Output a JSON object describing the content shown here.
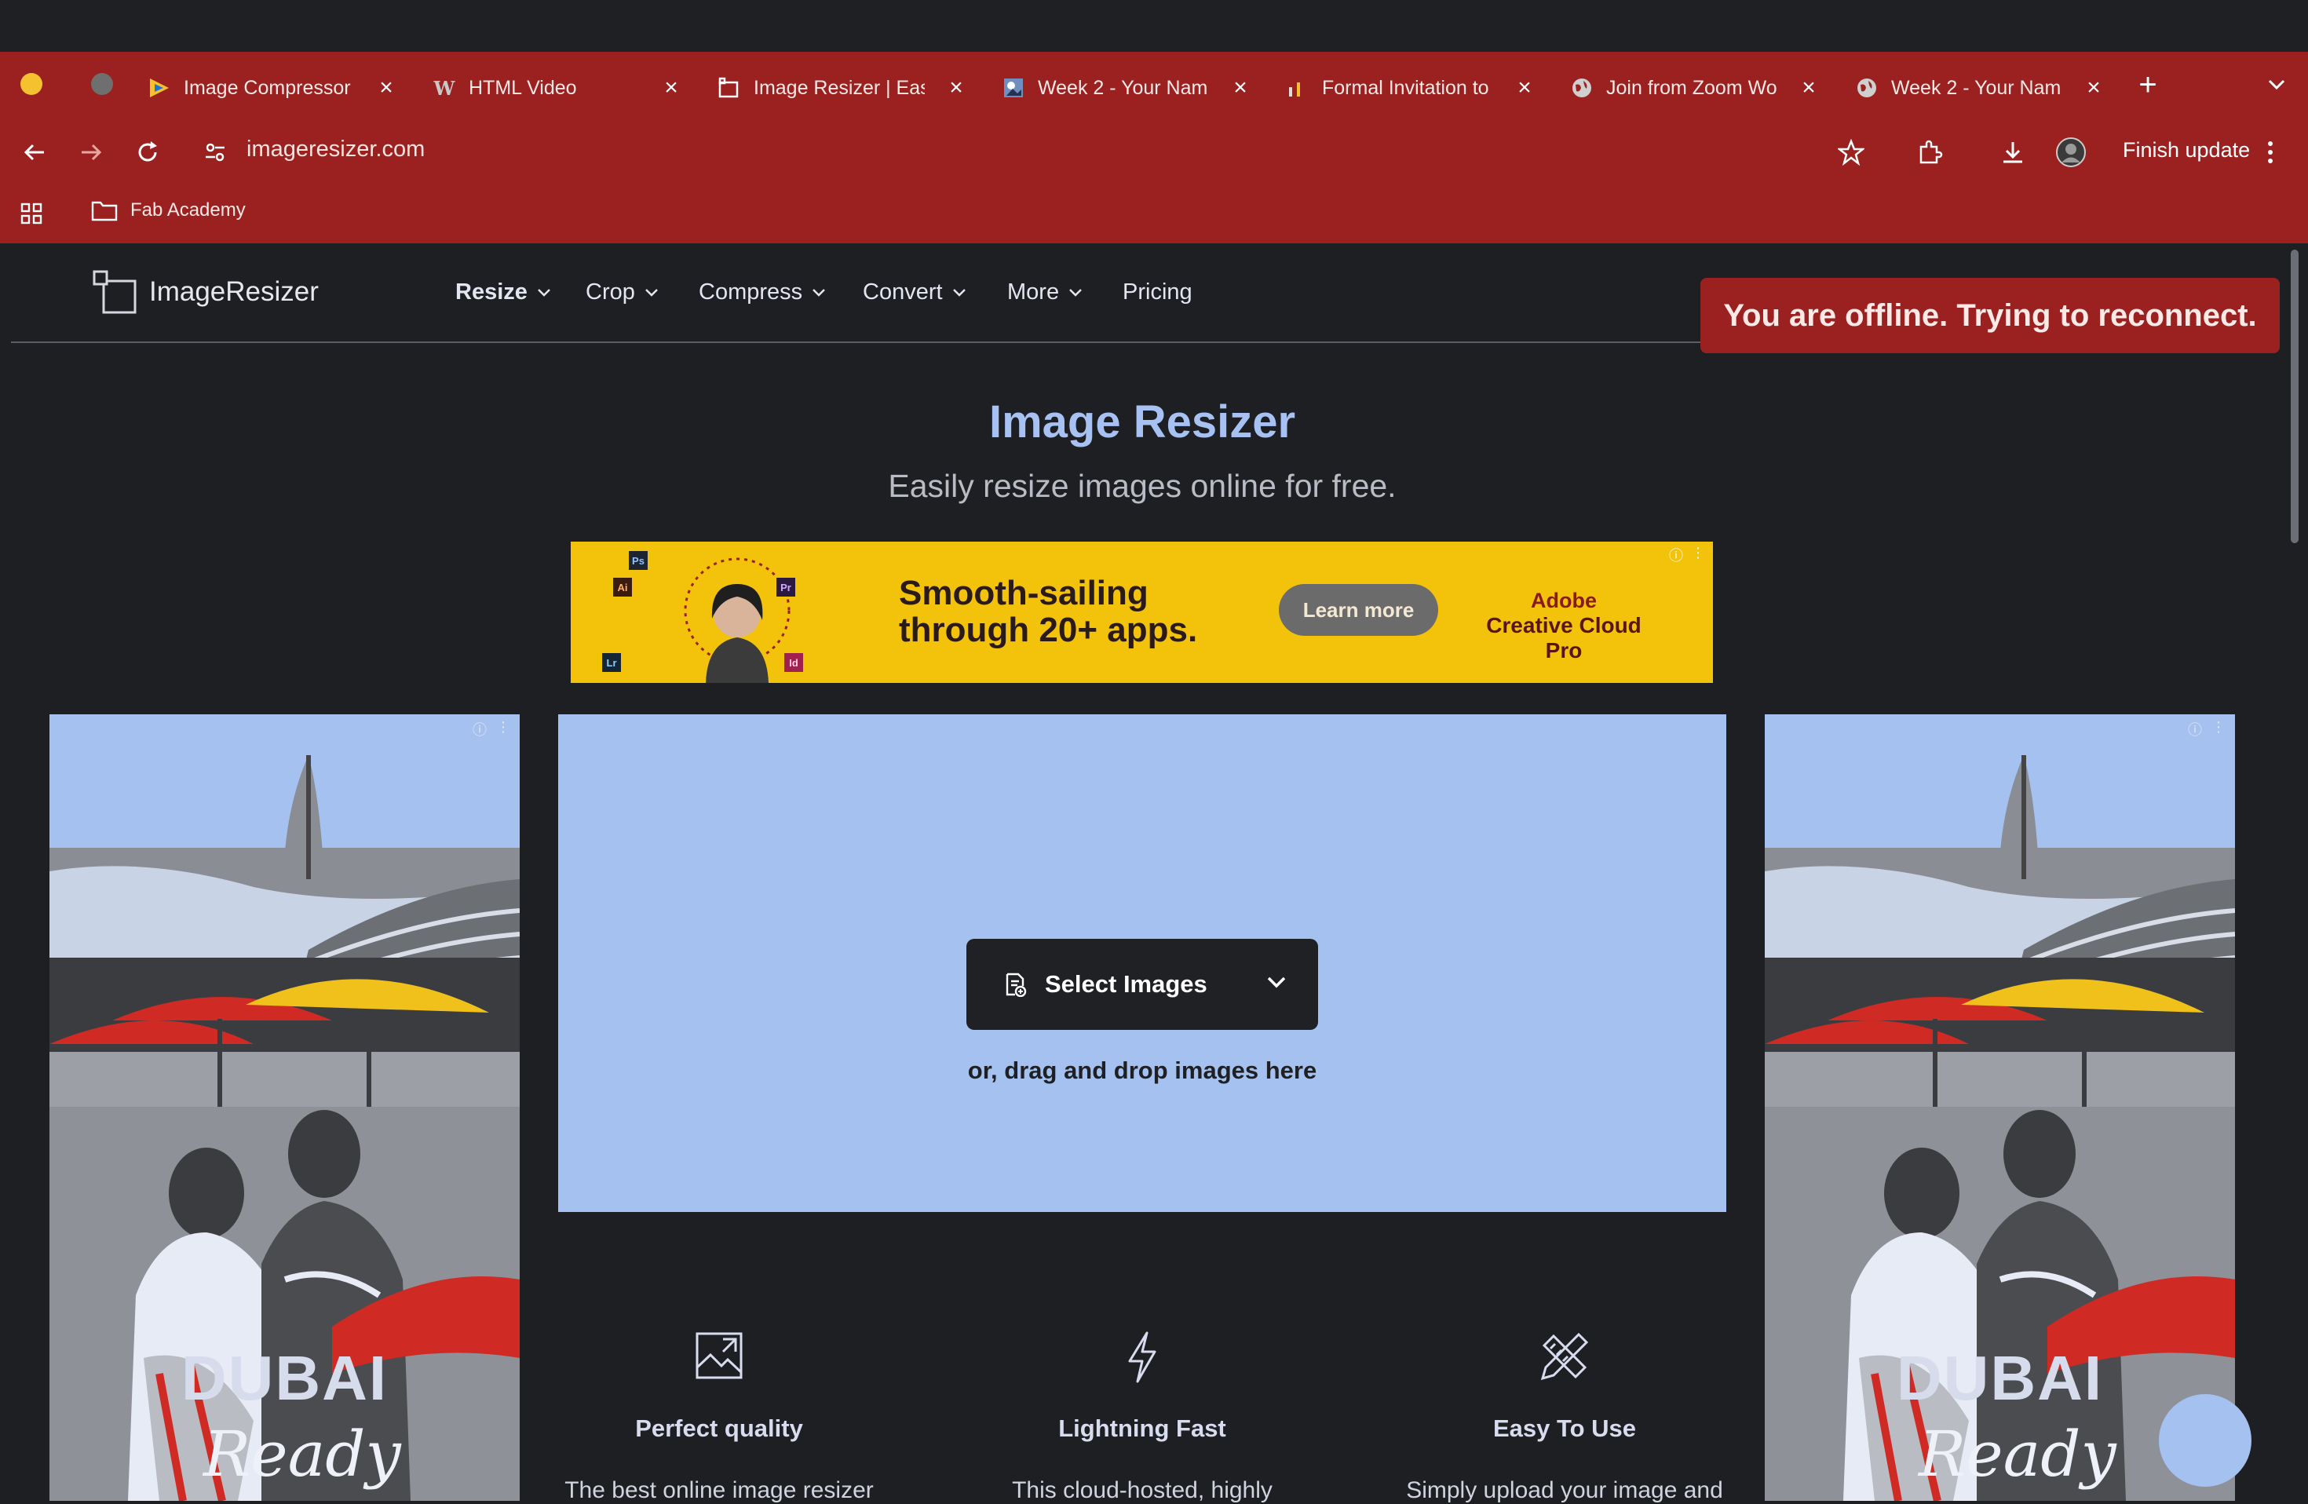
{
  "browser": {
    "tabs": [
      {
        "title": "Image Compressor",
        "icon": "image-compressor-favicon"
      },
      {
        "title": "HTML Video",
        "icon": "w-favicon"
      },
      {
        "title": "Image Resizer | Eas",
        "icon": "image-resizer-favicon"
      },
      {
        "title": "Week 2 - Your Nam",
        "icon": "document-favicon"
      },
      {
        "title": "Formal Invitation to",
        "icon": "invitation-favicon"
      },
      {
        "title": "Join from Zoom Wo",
        "icon": "globe-favicon"
      },
      {
        "title": "Week 2 - Your Nam",
        "icon": "globe-favicon"
      }
    ],
    "url": "imageresizer.com",
    "finish_update": "Finish update",
    "bookmarks": [
      {
        "label": "Fab Academy",
        "icon": "folder-icon"
      }
    ],
    "colors": {
      "chrome": "#9a211f",
      "page_bg": "#1e1f23"
    }
  },
  "site": {
    "logo_text": "ImageResizer",
    "nav": [
      {
        "label": "Resize",
        "has_dropdown": true,
        "active": true
      },
      {
        "label": "Crop",
        "has_dropdown": true
      },
      {
        "label": "Compress",
        "has_dropdown": true
      },
      {
        "label": "Convert",
        "has_dropdown": true
      },
      {
        "label": "More",
        "has_dropdown": true
      },
      {
        "label": "Pricing",
        "has_dropdown": false
      }
    ],
    "offline_banner": "You are offline. Trying to reconnect."
  },
  "hero": {
    "title": "Image Resizer",
    "subtitle": "Easily resize images online for free."
  },
  "ad_banner": {
    "headline_line1": "Smooth-sailing",
    "headline_line2": "through 20+ apps.",
    "button": "Learn more",
    "brand_line1": "Adobe",
    "brand_line2": "Creative Cloud Pro",
    "app_badges": [
      "Ps",
      "Ai",
      "Pr",
      "Lr",
      "Id"
    ]
  },
  "side_ads": {
    "title": "DUBAI",
    "tagline": "Ready"
  },
  "upload": {
    "select_button": "Select Images",
    "drag_text": "or, drag and drop images here",
    "accent": "#a5c1f0"
  },
  "features": [
    {
      "title": "Perfect quality",
      "desc": "The best online image resizer",
      "icon": "image-resize-icon"
    },
    {
      "title": "Lightning Fast",
      "desc": "This cloud-hosted, highly",
      "icon": "lightning-icon"
    },
    {
      "title": "Easy To Use",
      "desc": "Simply upload your image and",
      "icon": "pencil-ruler-icon"
    }
  ]
}
